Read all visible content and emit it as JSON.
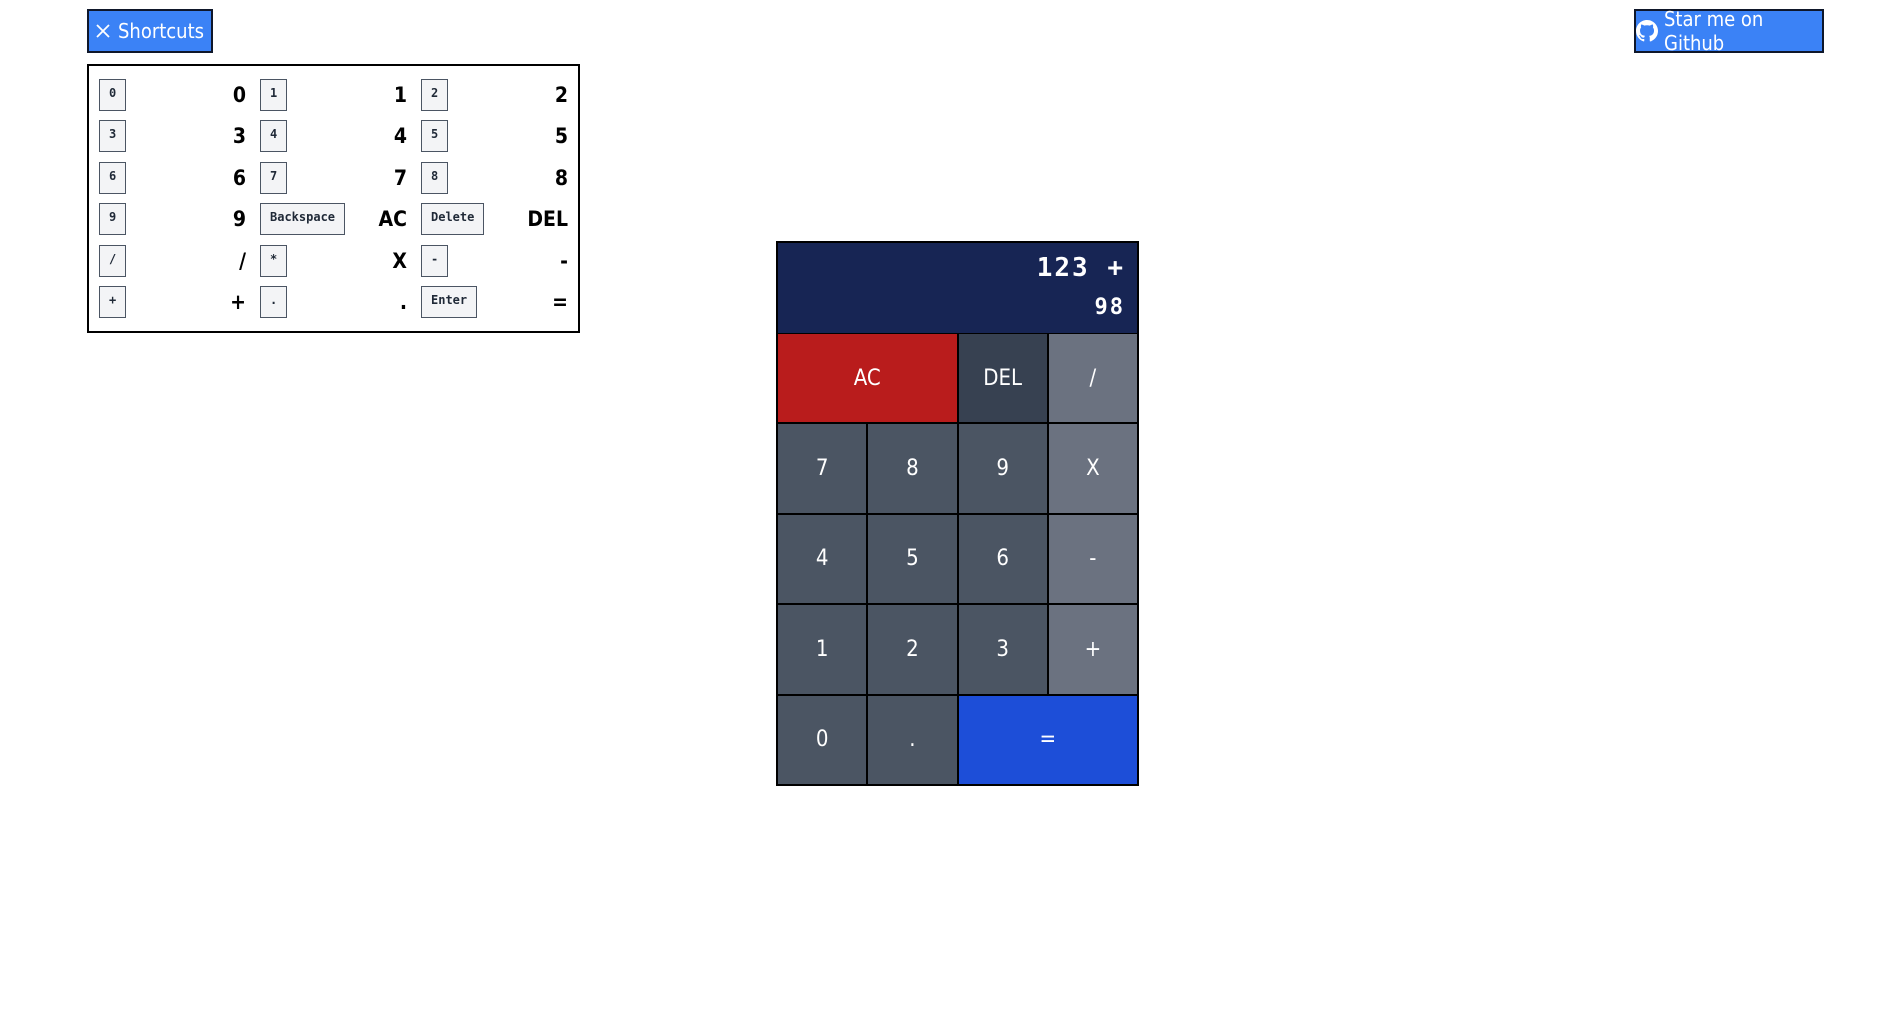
{
  "header": {
    "shortcuts_label": "Shortcuts",
    "github_label": "Star me on Github"
  },
  "shortcuts": [
    {
      "key": "0",
      "result": "0"
    },
    {
      "key": "1",
      "result": "1"
    },
    {
      "key": "2",
      "result": "2"
    },
    {
      "key": "3",
      "result": "3"
    },
    {
      "key": "4",
      "result": "4"
    },
    {
      "key": "5",
      "result": "5"
    },
    {
      "key": "6",
      "result": "6"
    },
    {
      "key": "7",
      "result": "7"
    },
    {
      "key": "8",
      "result": "8"
    },
    {
      "key": "9",
      "result": "9"
    },
    {
      "key": "Backspace",
      "result": "AC"
    },
    {
      "key": "Delete",
      "result": "DEL"
    },
    {
      "key": "/",
      "result": "/"
    },
    {
      "key": "*",
      "result": "X"
    },
    {
      "key": "-",
      "result": "-"
    },
    {
      "key": "+",
      "result": "+"
    },
    {
      "key": ".",
      "result": "."
    },
    {
      "key": "Enter",
      "result": "="
    }
  ],
  "calculator": {
    "previous": "123 +",
    "current": "98",
    "buttons": [
      {
        "label": "AC",
        "name": "all-clear-button"
      },
      {
        "label": "DEL",
        "name": "delete-button"
      },
      {
        "label": "/",
        "name": "divide-button"
      },
      {
        "label": "7",
        "name": "digit-7-button"
      },
      {
        "label": "8",
        "name": "digit-8-button"
      },
      {
        "label": "9",
        "name": "digit-9-button"
      },
      {
        "label": "X",
        "name": "multiply-button"
      },
      {
        "label": "4",
        "name": "digit-4-button"
      },
      {
        "label": "5",
        "name": "digit-5-button"
      },
      {
        "label": "6",
        "name": "digit-6-button"
      },
      {
        "label": "-",
        "name": "subtract-button"
      },
      {
        "label": "1",
        "name": "digit-1-button"
      },
      {
        "label": "2",
        "name": "digit-2-button"
      },
      {
        "label": "3",
        "name": "digit-3-button"
      },
      {
        "label": "+",
        "name": "add-button"
      },
      {
        "label": "0",
        "name": "digit-0-button"
      },
      {
        "label": ".",
        "name": "decimal-button"
      },
      {
        "label": "=",
        "name": "equals-button"
      }
    ]
  },
  "colors": {
    "primary_blue": "#3b82f6",
    "display_bg": "#172554",
    "clear_red": "#b91c1c",
    "equals_blue": "#1d4ed8",
    "digit_gray": "#4b5563",
    "operator_gray": "#6b7280",
    "delete_gray": "#374151"
  },
  "icons": {
    "shortcuts_toggle": "close-icon",
    "github": "github-icon"
  }
}
